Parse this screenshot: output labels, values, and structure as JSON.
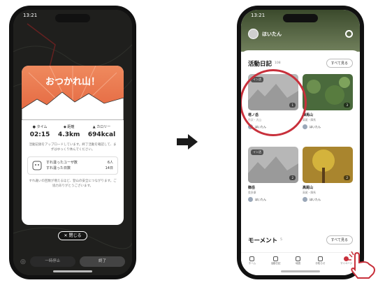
{
  "left_phone": {
    "status_time": "13:21",
    "card_title": "おつかれ山！",
    "stats": [
      {
        "icon": "clock-icon",
        "label": "タイム",
        "value": "02:15"
      },
      {
        "icon": "footprint-icon",
        "label": "距離",
        "value": "4.3km"
      },
      {
        "icon": "flame-icon",
        "label": "カロリー",
        "value": "694kcal"
      }
    ],
    "note": "活動記録をアップロードしています。終了活動を確認して、まずはゆっくり休んでください。",
    "crossing": {
      "row1_label": "すれ違ったユーザ数",
      "row1_value": "6人",
      "row2_label": "すれ違った日数",
      "row2_value": "14日",
      "caption": "すれ違いの回数が増えるほど、登山の安全につながります。ご協力ありがとうございます。"
    },
    "close_label": "✕ 閉じる",
    "bottom_left": "一時停止",
    "bottom_right": "終了"
  },
  "right_phone": {
    "status_time": "13:21",
    "user_name": "ほいたん",
    "activity": {
      "title": "活動日記",
      "count": "108",
      "see_all": "すべて見る",
      "tiles": [
        {
          "tag": "イン活",
          "photos": "1",
          "name": "塔ノ岳",
          "sub": "丹沢・大山",
          "user": "ほいたん",
          "type": "gray"
        },
        {
          "tag": "",
          "photos": "3",
          "name": "陣馬山",
          "sub": "高尾・陣馬",
          "user": "ほいたん",
          "type": "green"
        },
        {
          "tag": "イン活",
          "photos": "2",
          "name": "御岳",
          "sub": "奥多摩",
          "user": "ほいたん",
          "type": "gray"
        },
        {
          "tag": "",
          "photos": "2",
          "name": "高尾山",
          "sub": "高尾・陣馬",
          "user": "ほいたん",
          "type": "autumn"
        }
      ]
    },
    "moment": {
      "title": "モーメント",
      "count": "5",
      "see_all": "すべて見る",
      "users": [
        "ほいたん",
        "ほいたん"
      ]
    },
    "tabs": [
      "ホーム",
      "活動日記",
      "地図",
      "お知らせ",
      "マイページ"
    ]
  },
  "colors": {
    "accent_red": "#c8303b",
    "hero_orange": "#e3633d"
  }
}
